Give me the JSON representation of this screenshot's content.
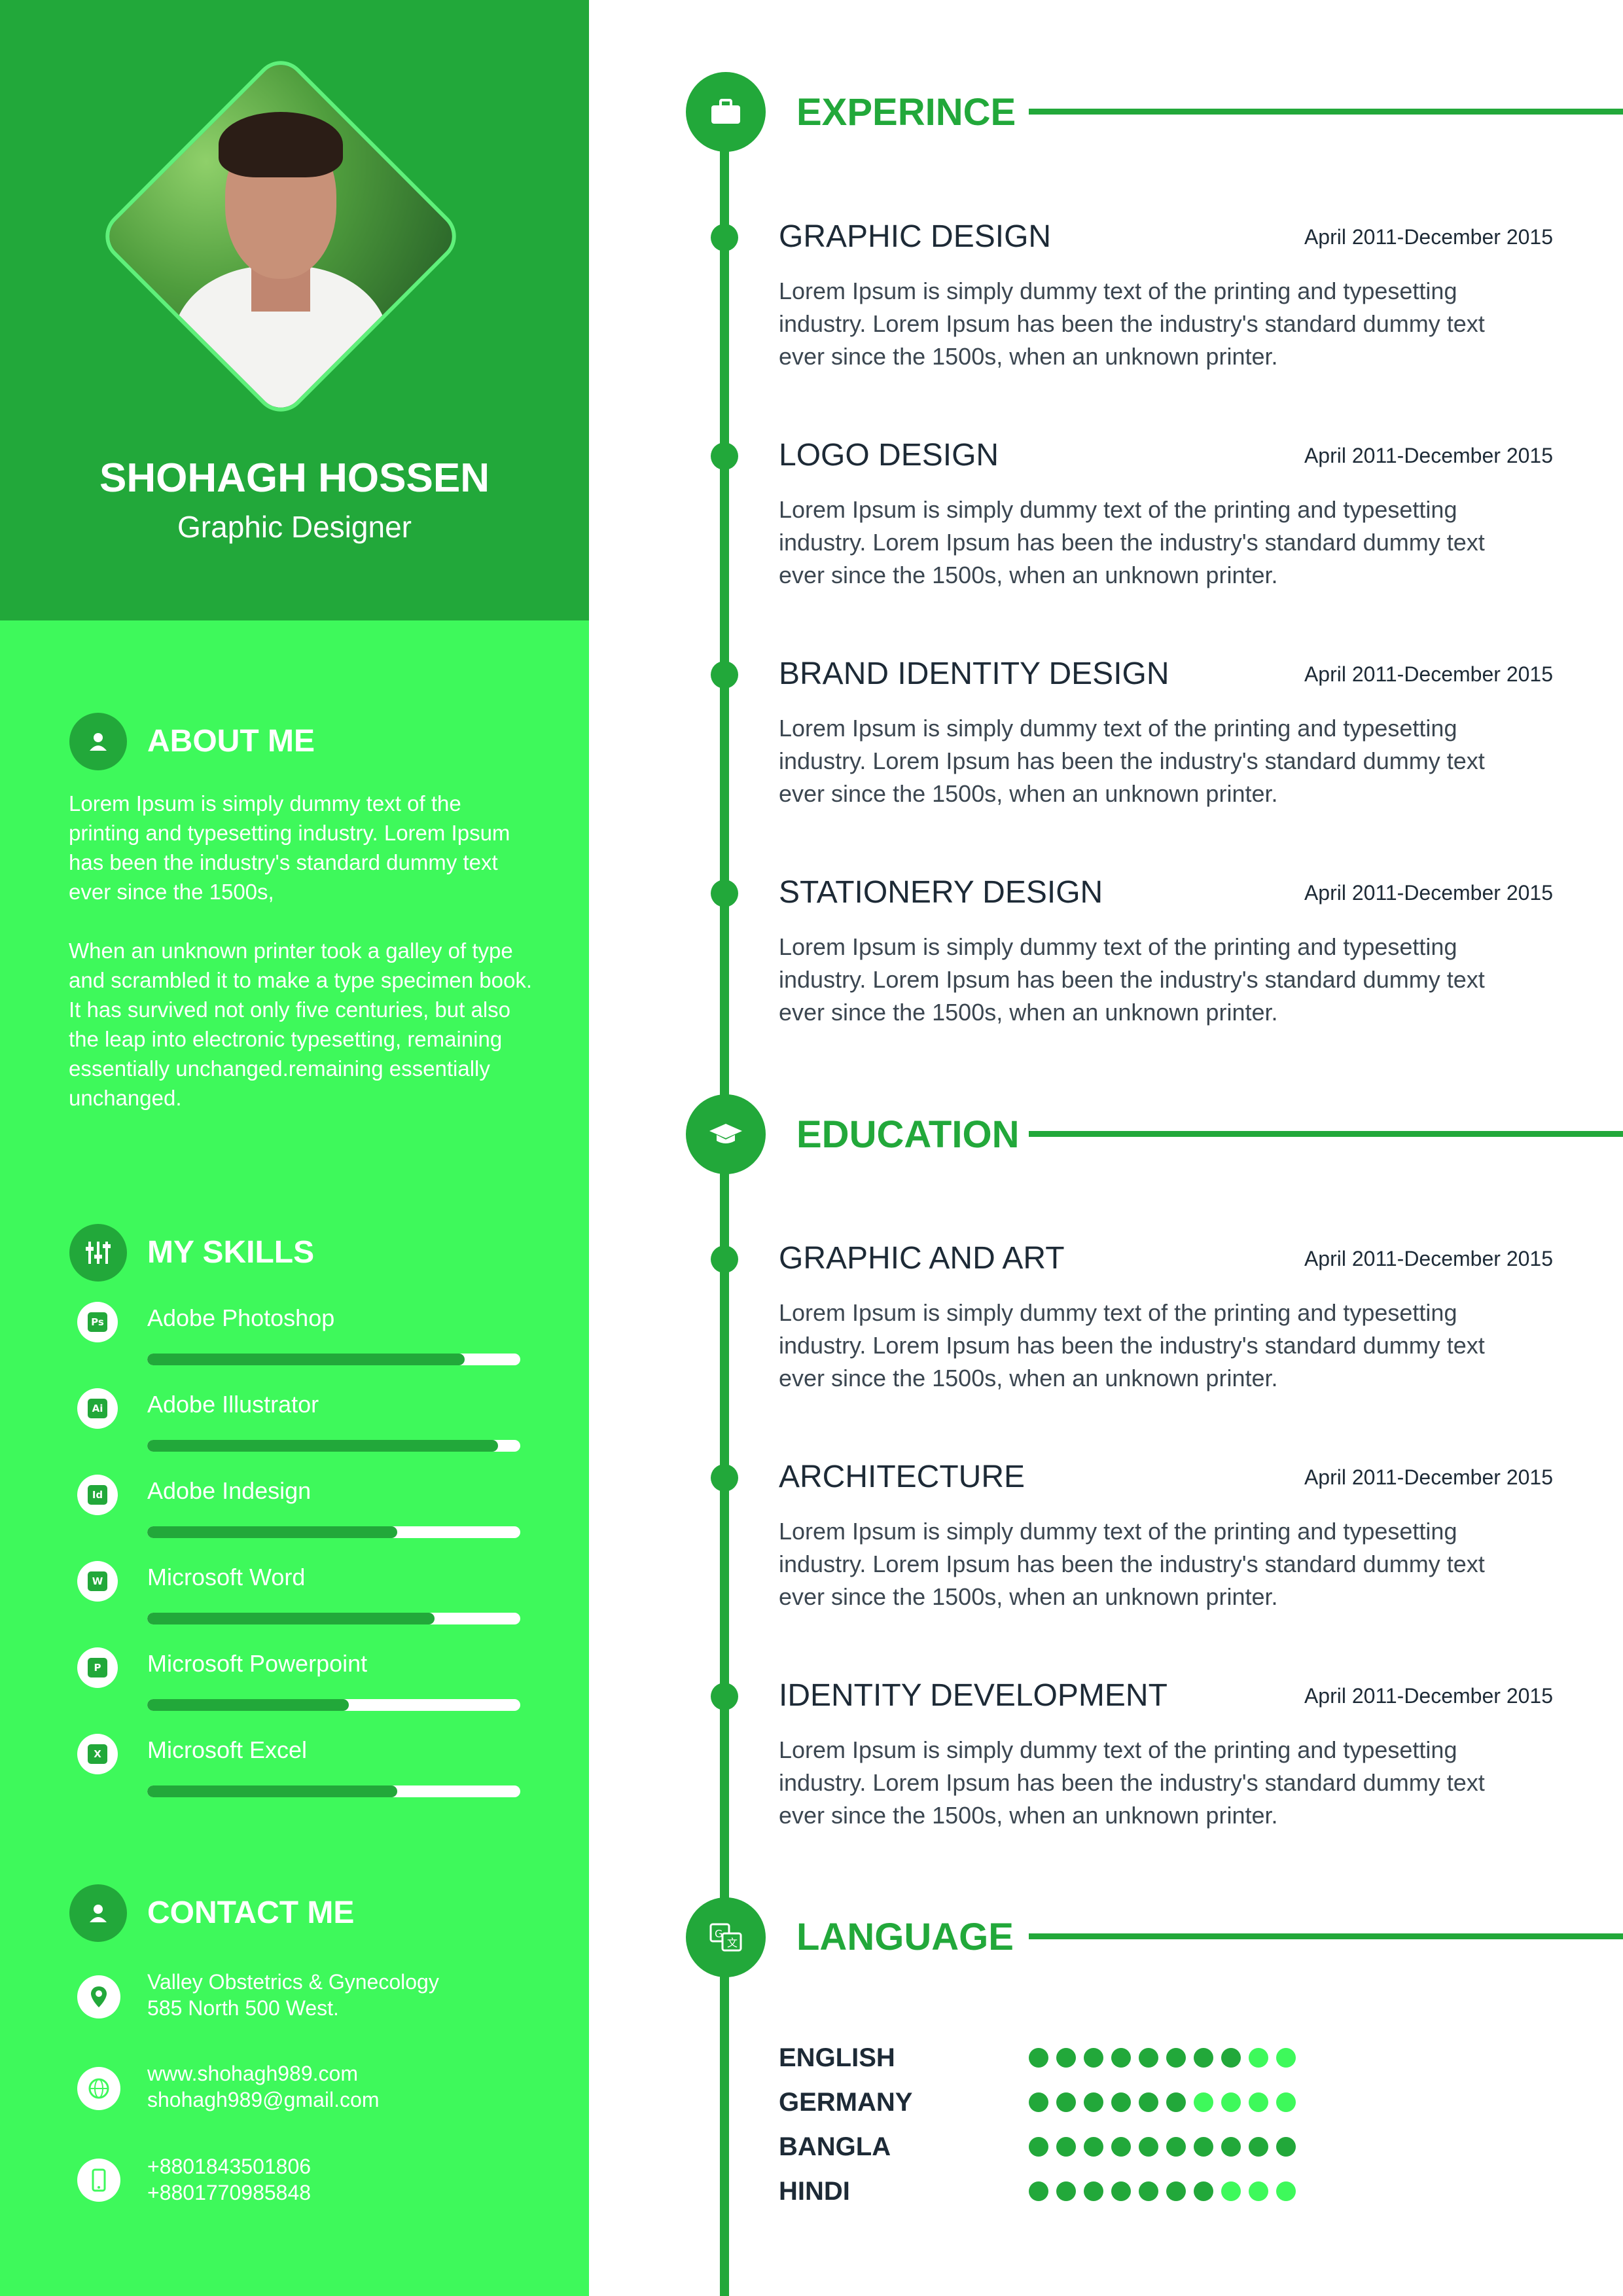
{
  "profile": {
    "name": "SHOHAGH HOSSEN",
    "role": "Graphic Designer"
  },
  "about": {
    "title": "ABOUT ME",
    "p1": "Lorem Ipsum is simply dummy text of the printing and typesetting industry. Lorem Ipsum has been the industry's standard dummy text ever since the 1500s,",
    "p2": "When an unknown printer took a galley of type and scrambled it to make a type specimen book. It has survived not only five centuries, but also the leap into electronic typesetting, remaining essentially unchanged.remaining essentially unchanged."
  },
  "skills": {
    "title": "MY SKILLS",
    "items": [
      {
        "label": "Adobe Photoshop",
        "icon": "Ps",
        "level": 0.85
      },
      {
        "label": "Adobe Illustrator",
        "icon": "Ai",
        "level": 0.94
      },
      {
        "label": "Adobe Indesign",
        "icon": "Id",
        "level": 0.67
      },
      {
        "label": "Microsoft Word",
        "icon": "W",
        "level": 0.77
      },
      {
        "label": "Microsoft Powerpoint",
        "icon": "P",
        "level": 0.54
      },
      {
        "label": "Microsoft Excel",
        "icon": "X",
        "level": 0.67
      }
    ]
  },
  "contact": {
    "title": "CONTACT ME",
    "address1": "Valley Obstetrics & Gynecology",
    "address2": "585 North 500 West.",
    "web": "www.shohagh989.com",
    "email": "shohagh989@gmail.com",
    "phone1": "+8801843501806",
    "phone2": "+8801770985848"
  },
  "experience": {
    "title": "EXPERINCE",
    "items": [
      {
        "title": "GRAPHIC DESIGN",
        "date": "April 2011-December 2015",
        "desc": "Lorem Ipsum is simply dummy text of the printing and typesetting industry. Lorem Ipsum has been the industry's standard dummy text ever since the 1500s, when an unknown printer."
      },
      {
        "title": "LOGO DESIGN",
        "date": "April 2011-December 2015",
        "desc": "Lorem Ipsum is simply dummy text of the printing and typesetting industry. Lorem Ipsum has been the industry's standard dummy text ever since the 1500s, when an unknown printer."
      },
      {
        "title": "BRAND IDENTITY DESIGN",
        "date": "April 2011-December 2015",
        "desc": "Lorem Ipsum is simply dummy text of the printing and typesetting industry. Lorem Ipsum has been the industry's standard dummy text ever since the 1500s, when an unknown printer."
      },
      {
        "title": "STATIONERY DESIGN",
        "date": "April 2011-December 2015",
        "desc": "Lorem Ipsum is simply dummy text of the printing and typesetting industry. Lorem Ipsum has been the industry's standard dummy text ever since the 1500s, when an unknown printer."
      }
    ]
  },
  "education": {
    "title": "EDUCATION",
    "items": [
      {
        "title": "GRAPHIC AND ART",
        "date": "April 2011-December 2015",
        "desc": "Lorem Ipsum is simply dummy text of the printing and typesetting industry. Lorem Ipsum has been the industry's standard dummy text ever since the 1500s, when an unknown printer."
      },
      {
        "title": "ARCHITECTURE",
        "date": "April 2011-December 2015",
        "desc": "Lorem Ipsum is simply dummy text of the printing and typesetting industry. Lorem Ipsum has been the industry's standard dummy text ever since the 1500s, when an unknown printer."
      },
      {
        "title": "IDENTITY DEVELOPMENT",
        "date": "April 2011-December 2015",
        "desc": "Lorem Ipsum is simply dummy text of the printing and typesetting industry. Lorem Ipsum has been the industry's standard dummy text ever since the 1500s, when an unknown printer."
      }
    ]
  },
  "language": {
    "title": "LANGUAGE",
    "items": [
      {
        "name": "ENGLISH",
        "level": 8,
        "max": 10
      },
      {
        "name": "GERMANY",
        "level": 6,
        "max": 10
      },
      {
        "name": "BANGLA",
        "level": 10,
        "max": 10
      },
      {
        "name": "HINDI",
        "level": 7,
        "max": 10
      }
    ]
  },
  "colors": {
    "dark_green": "#22a83a",
    "light_green": "#3ef95b",
    "text_dark": "#1d2a36"
  }
}
